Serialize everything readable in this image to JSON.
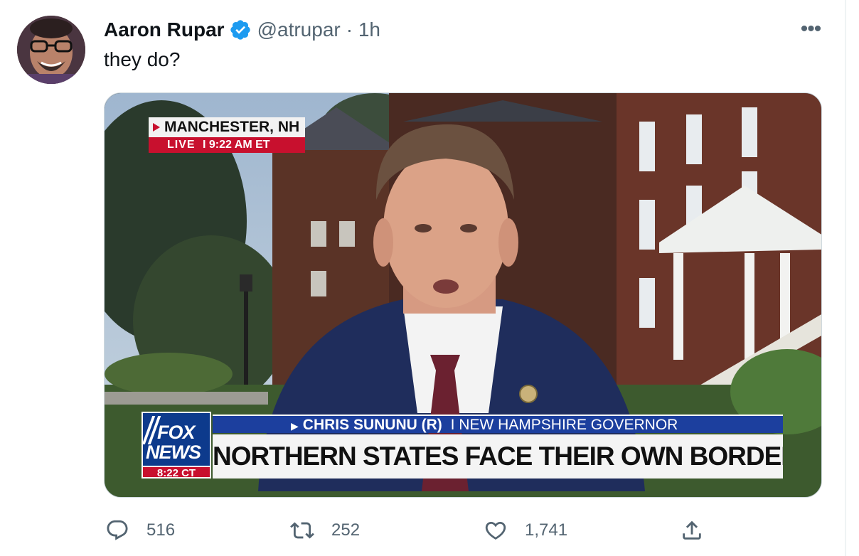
{
  "tweet": {
    "author": {
      "display_name": "Aaron Rupar",
      "handle": "@atrupar",
      "verified": true,
      "time_meta": "· 1h"
    },
    "text": "they do?",
    "more_icon": "more-dots-icon"
  },
  "media": {
    "location_tag": {
      "city": "MANCHESTER, NH",
      "live_label": "LIVE",
      "time": "I 9:22 AM ET"
    },
    "network_logo": {
      "line1": "FOX",
      "line2": "NEWS",
      "time": "8:22 CT"
    },
    "chyron": {
      "name": "CHRIS SUNUNU (R)",
      "title": "I NEW HAMPSHIRE GOVERNOR",
      "headline": "NORTHERN STATES FACE THEIR OWN BORDER CRISIS"
    }
  },
  "actions": {
    "reply": {
      "icon": "reply-icon",
      "count": "516"
    },
    "retweet": {
      "icon": "retweet-icon",
      "count": "252"
    },
    "like": {
      "icon": "heart-icon",
      "count": "1,741"
    },
    "share": {
      "icon": "share-icon"
    }
  },
  "colors": {
    "verified_blue": "#1d9bf0",
    "secondary_text": "#536471",
    "fox_red": "#c8102e",
    "fox_blue": "#1c3f9e"
  }
}
